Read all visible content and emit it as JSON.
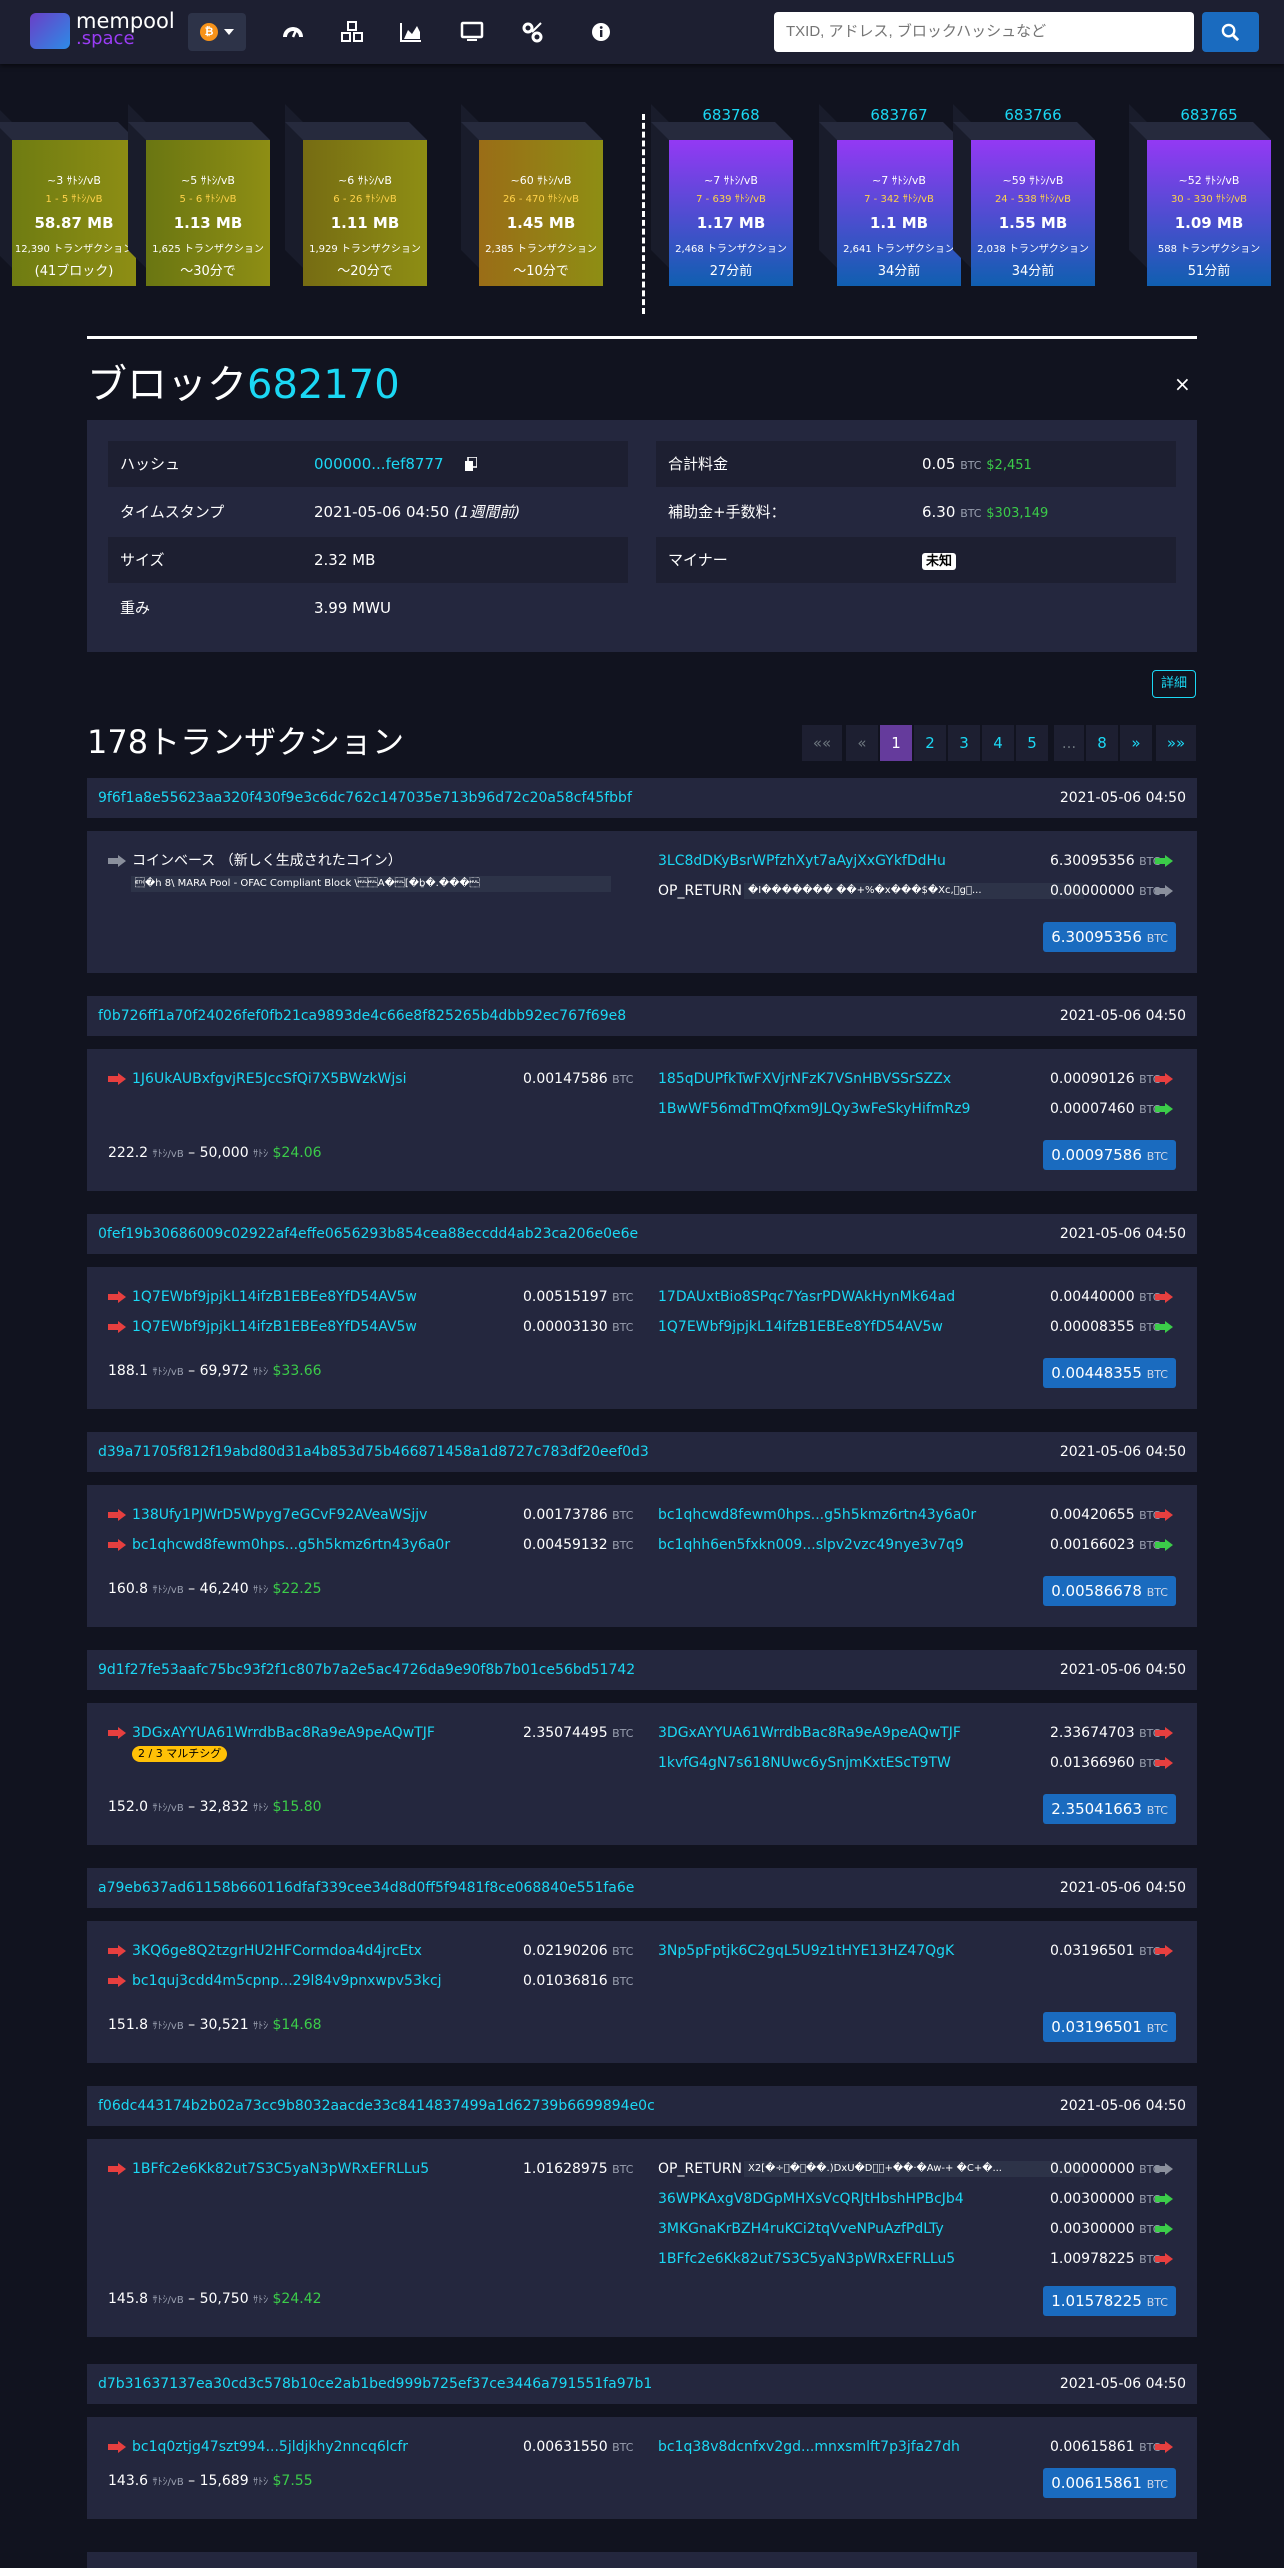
{
  "header": {
    "logo_top": "mempool",
    "logo_bottom": ".space",
    "network_symbol": "₿",
    "search_placeholder": "TXID, アドレス, ブロックハッシュなど",
    "nav_icons": [
      "dashboard-icon",
      "cubes-icon",
      "chart-icon",
      "tv-icon",
      "tools-icon",
      "info-icon"
    ]
  },
  "mempool_blocks": [
    {
      "fee": "~3 ｻﾄｼ/vB",
      "range": "1 - 5 ｻﾄｼ/vB",
      "size": "58.87 MB",
      "txs": "12,390 トランザクション",
      "time": "(41ブロック)",
      "color": "#6f7c12"
    },
    {
      "fee": "~5 ｻﾄｼ/vB",
      "range": "5 - 6 ｻﾄｼ/vB",
      "size": "1.13 MB",
      "txs": "1,625 トランザクション",
      "time": "〜30分で",
      "color": "#6a7612"
    },
    {
      "fee": "~6 ｻﾄｼ/vB",
      "range": "6 - 26 ｻﾄｼ/vB",
      "size": "1.11 MB",
      "txs": "1,929 トランザクション",
      "time": "〜20分で",
      "color": "#766c13"
    },
    {
      "fee": "~60 ｻﾄｼ/vB",
      "range": "26 - 470 ｻﾄｼ/vB",
      "size": "1.45 MB",
      "txs": "2,385 トランザクション",
      "time": "〜10分で",
      "color": "#9a6d17"
    }
  ],
  "blocks": [
    {
      "height": "683768",
      "fee": "~7 ｻﾄｼ/vB",
      "range": "7 - 639 ｻﾄｼ/vB",
      "size": "1.17 MB",
      "txs": "2,468 トランザクション",
      "time": "27分前"
    },
    {
      "height": "683767",
      "fee": "~7 ｻﾄｼ/vB",
      "range": "7 - 342 ｻﾄｼ/vB",
      "size": "1.1 MB",
      "txs": "2,641 トランザクション",
      "time": "34分前"
    },
    {
      "height": "683766",
      "fee": "~59 ｻﾄｼ/vB",
      "range": "24 - 538 ｻﾄｼ/vB",
      "size": "1.55 MB",
      "txs": "2,038 トランザクション",
      "time": "34分前"
    },
    {
      "height": "683765",
      "fee": "~52 ｻﾄｼ/vB",
      "range": "30 - 330 ｻﾄｼ/vB",
      "size": "1.09 MB",
      "txs": "588 トランザクション",
      "time": "51分前"
    }
  ],
  "block": {
    "title": "ブロック",
    "height": "682170",
    "close": "×",
    "hash_label": "ハッシュ",
    "hash": "000000...fef8777",
    "timestamp_label": "タイムスタンプ",
    "timestamp": "2021-05-06 04:50",
    "timestamp_rel": "(1週間前)",
    "size_label": "サイズ",
    "size": "2.32 MB",
    "weight_label": "重み",
    "weight": "3.99 MWU",
    "fees_label": "合計料金",
    "fees": "0.05",
    "fees_unit": "BTC",
    "fees_usd": "$2,451",
    "reward_label": "補助金+手数料：",
    "reward": "6.30",
    "reward_unit": "BTC",
    "reward_usd": "$303,149",
    "miner_label": "マイナー",
    "miner": "未知",
    "details": "詳細"
  },
  "tx_count": "178トランザクション",
  "pagination": [
    "««",
    "«",
    "1",
    "2",
    "3",
    "4",
    "5",
    "...",
    "8",
    "»",
    "»»"
  ],
  "txs": [
    {
      "txid": "9f6f1a8e55623aa320f430f9e3c6dc762c147035e713b96d72c20a58cf45fbbf",
      "time": "2021-05-06 04:50",
      "inputs": [
        {
          "addr": "コインベース （新しく生成されたコイン）",
          "coinbase": true,
          "script": "\u0003�h 8\\ MARA Pool - OFAC Compliant Block \\\u0000\u0000A�\u0000[�ḇ�.���\u0000"
        }
      ],
      "outputs": [
        {
          "addr": "3LC8dDKyBsrWPfzhXyt7aAyjXxGYkfDdHu",
          "amt": "6.30095356",
          "dir": "green"
        },
        {
          "addr": "OP_RETURN",
          "script": "�I������� ��+%�x���$�Xc,\u0000g\u0000...",
          "amt": "0.00000000",
          "dir": "gray"
        }
      ],
      "total": "6.30095356"
    },
    {
      "txid": "f0b726ff1a70f24026fef0fb21ca9893de4c66e8f825265b4dbb92ec767f69e8",
      "time": "2021-05-06 04:50",
      "inputs": [
        {
          "addr": "1J6UkAUBxfgvjRE5JccSfQi7X5BWzkWjsi",
          "amt": "0.00147586"
        }
      ],
      "outputs": [
        {
          "addr": "185qDUPfkTwFXVjrNFzK7VSnHBVSSrSZZx",
          "amt": "0.00090126",
          "dir": "red"
        },
        {
          "addr": "1BwWF56mdTmQfxm9JLQy3wFeSkyHifmRz9",
          "amt": "0.00007460",
          "dir": "green"
        }
      ],
      "fee_rate": "222.2",
      "fee_total": "50,000",
      "fee_usd": "$24.06",
      "total": "0.00097586"
    },
    {
      "txid": "0fef19b30686009c02922af4effe0656293b854cea88eccdd4ab23ca206e0e6e",
      "time": "2021-05-06 04:50",
      "inputs": [
        {
          "addr": "1Q7EWbf9jpjkL14ifzB1EBEe8YfD54AV5w",
          "amt": "0.00515197"
        },
        {
          "addr": "1Q7EWbf9jpjkL14ifzB1EBEe8YfD54AV5w",
          "amt": "0.00003130"
        }
      ],
      "outputs": [
        {
          "addr": "17DAUxtBio8SPqc7YasrPDWAkHynMk64ad",
          "amt": "0.00440000",
          "dir": "red"
        },
        {
          "addr": "1Q7EWbf9jpjkL14ifzB1EBEe8YfD54AV5w",
          "amt": "0.00008355",
          "dir": "green"
        }
      ],
      "fee_rate": "188.1",
      "fee_total": "69,972",
      "fee_usd": "$33.66",
      "total": "0.00448355"
    },
    {
      "txid": "d39a71705f812f19abd80d31a4b853d75b466871458a1d8727c783df20eef0d3",
      "time": "2021-05-06 04:50",
      "inputs": [
        {
          "addr": "138Ufy1PJWrD5Wpyg7eGCvF92AVeaWSjjv",
          "amt": "0.00173786"
        },
        {
          "addr": "bc1qhcwd8fewm0hps...g5h5kmz6rtn43y6a0r",
          "amt": "0.00459132"
        }
      ],
      "outputs": [
        {
          "addr": "bc1qhcwd8fewm0hps...g5h5kmz6rtn43y6a0r",
          "amt": "0.00420655",
          "dir": "red"
        },
        {
          "addr": "bc1qhh6en5fxkn009...slpv2vzc49nye3v7q9",
          "amt": "0.00166023",
          "dir": "green"
        }
      ],
      "fee_rate": "160.8",
      "fee_total": "46,240",
      "fee_usd": "$22.25",
      "total": "0.00586678"
    },
    {
      "txid": "9d1f27fe53aafc75bc93f2f1c807b7a2e5ac4726da9e90f8b7b01ce56bd51742",
      "time": "2021-05-06 04:50",
      "inputs": [
        {
          "addr": "3DGxAYYUA61WrrdbBac8Ra9eA9peAQwTJF",
          "amt": "2.35074495",
          "badge": "2 / 3 マルチシグ"
        }
      ],
      "outputs": [
        {
          "addr": "3DGxAYYUA61WrrdbBac8Ra9eA9peAQwTJF",
          "amt": "2.33674703",
          "dir": "red"
        },
        {
          "addr": "1kvfG4gN7s618NUwc6ySnjmKxtEScT9TW",
          "amt": "0.01366960",
          "dir": "red"
        }
      ],
      "fee_rate": "152.0",
      "fee_total": "32,832",
      "fee_usd": "$15.80",
      "total": "2.35041663"
    },
    {
      "txid": "a79eb637ad61158b660116dfaf339cee34d8d0ff5f9481f8ce068840e551fa6e",
      "time": "2021-05-06 04:50",
      "inputs": [
        {
          "addr": "3KQ6ge8Q2tzgrHU2HFCormdoa4d4jrcEtx",
          "amt": "0.02190206"
        },
        {
          "addr": "bc1quj3cdd4m5cpnp...29l84v9pnxwpv53kcj",
          "amt": "0.01036816"
        }
      ],
      "outputs": [
        {
          "addr": "3Np5pFptjk6C2gqL5U9z1tHYE13HZ47QgK",
          "amt": "0.03196501",
          "dir": "red"
        }
      ],
      "fee_rate": "151.8",
      "fee_total": "30,521",
      "fee_usd": "$14.68",
      "total": "0.03196501"
    },
    {
      "txid": "f06dc443174b2b02a73cc9b8032aacde33c8414837499a1d62739b6699894e0c",
      "time": "2021-05-06 04:50",
      "inputs": [
        {
          "addr": "1BFfc2e6Kk82ut7S3C5yaN3pWRxEFRLLu5",
          "amt": "1.01628975"
        }
      ],
      "outputs": [
        {
          "addr": "OP_RETURN",
          "script": "X2[�÷\u0000�\u0000��.)DxU�D\u0000\u0000+��·�Aw-+ �C+�...",
          "amt": "0.00000000",
          "dir": "gray"
        },
        {
          "addr": "36WPKAxgV8DGpMHXsVcQRJtHbshHPBcJb4",
          "amt": "0.00300000",
          "dir": "green"
        },
        {
          "addr": "3MKGnaKrBZH4ruKCi2tqVveNPuAzfPdLTy",
          "amt": "0.00300000",
          "dir": "green"
        },
        {
          "addr": "1BFfc2e6Kk82ut7S3C5yaN3pWRxEFRLLu5",
          "amt": "1.00978225",
          "dir": "red"
        }
      ],
      "fee_rate": "145.8",
      "fee_total": "50,750",
      "fee_usd": "$24.42",
      "total": "1.01578225"
    },
    {
      "txid": "d7b31637137ea30cd3c578b10ce2ab1bed999b725ef37ce3446a791551fa97b1",
      "time": "2021-05-06 04:50",
      "inputs": [
        {
          "addr": "bc1q0ztjg47szt994...5jldjkhy2nncq6lcfr",
          "amt": "0.00631550"
        }
      ],
      "outputs": [
        {
          "addr": "bc1q38v8dcnfxv2gd...mnxsmlft7p3jfa27dh",
          "amt": "0.00615861",
          "dir": "red"
        }
      ],
      "fee_rate": "143.6",
      "fee_total": "15,689",
      "fee_usd": "$7.55",
      "total": "0.00615861"
    }
  ],
  "units": {
    "btc": "BTC",
    "satvb": "ｻﾄｼ/vB",
    "sat": "ｻﾄｼ",
    "dash": "–"
  },
  "colors": {
    "accent": "#1bd8f4",
    "red": "#e73f3f",
    "green": "#3bcc49",
    "gray": "#8a8f9c",
    "primary": "#1a6bbf",
    "purple": "#653b9c"
  }
}
